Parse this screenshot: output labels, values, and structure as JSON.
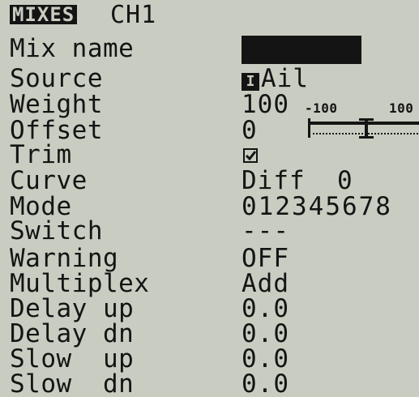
{
  "header": {
    "title": "MIXES",
    "channel": "CH1"
  },
  "fields": {
    "mix_name": {
      "label": "Mix name",
      "value": ""
    },
    "source": {
      "label": "Source",
      "icon": "I",
      "value": "Ail"
    },
    "weight": {
      "label": "Weight",
      "value": "100",
      "gauge_min": "-100",
      "gauge_max": "100"
    },
    "offset": {
      "label": "Offset",
      "value": "0"
    },
    "trim": {
      "label": "Trim",
      "checked": true
    },
    "curve": {
      "label": "Curve",
      "value": "Diff  0"
    },
    "mode": {
      "label": "Mode",
      "value": "012345678"
    },
    "switch": {
      "label": "Switch",
      "value": "---"
    },
    "warning": {
      "label": "Warning",
      "value": "OFF"
    },
    "multiplex": {
      "label": "Multiplex",
      "value": "Add"
    },
    "delay_up": {
      "label": "Delay up",
      "value": "0.0"
    },
    "delay_dn": {
      "label": "Delay dn",
      "value": "0.0"
    },
    "slow_up": {
      "label": "Slow  up",
      "value": "0.0"
    },
    "slow_dn": {
      "label": "Slow  dn",
      "value": "0.0"
    }
  },
  "colors": {
    "background": "#c9cdc1",
    "ink": "#141414"
  }
}
